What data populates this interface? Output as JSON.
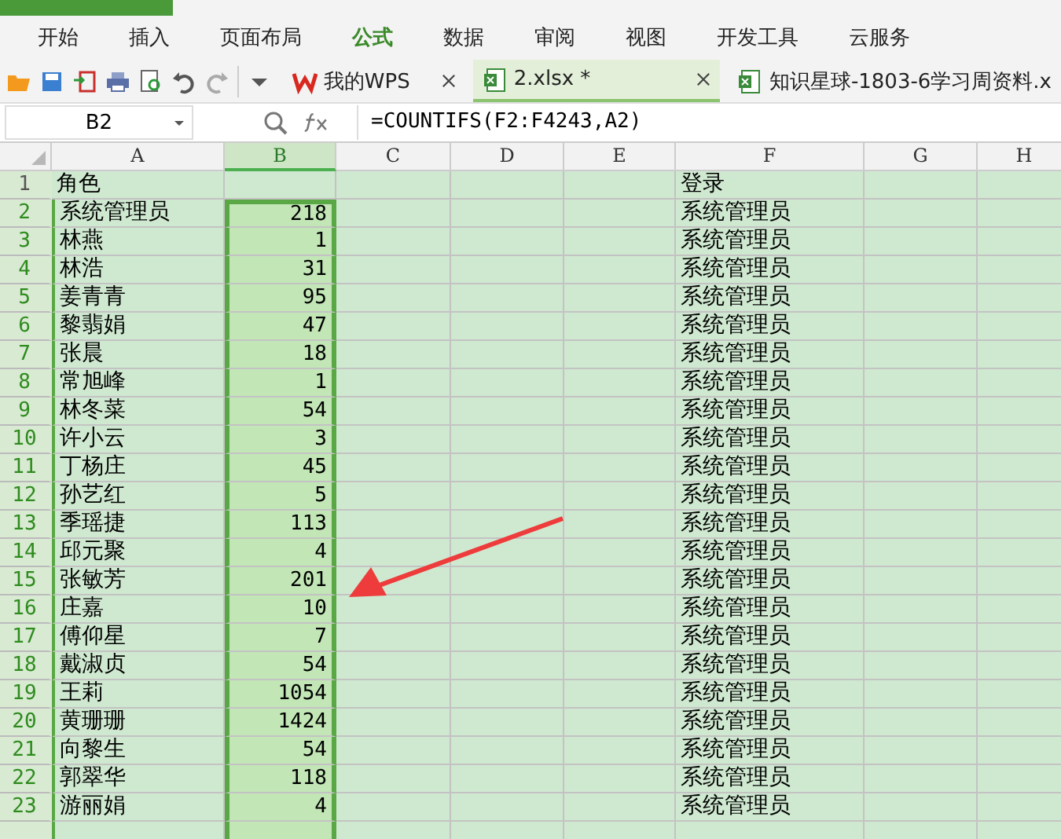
{
  "ribbon_tabs": [
    {
      "label": "开始",
      "selected": false
    },
    {
      "label": "插入",
      "selected": false
    },
    {
      "label": "页面布局",
      "selected": false
    },
    {
      "label": "公式",
      "selected": true
    },
    {
      "label": "数据",
      "selected": false
    },
    {
      "label": "审阅",
      "selected": false
    },
    {
      "label": "视图",
      "selected": false
    },
    {
      "label": "开发工具",
      "selected": false
    },
    {
      "label": "云服务",
      "selected": false
    }
  ],
  "doc_tabs": [
    {
      "kind": "wps",
      "label": "我的WPS",
      "selected": false
    },
    {
      "kind": "sheet",
      "label": "2.xlsx *",
      "selected": true
    },
    {
      "kind": "sheet",
      "label": "知识星球-1803-6学习周资料.x",
      "selected": false
    }
  ],
  "name_box": "B2",
  "formula": "=COUNTIFS(F2:F4243,A2)",
  "columns": [
    {
      "label": "A",
      "selected": false
    },
    {
      "label": "B",
      "selected": true
    },
    {
      "label": "C",
      "selected": false
    },
    {
      "label": "D",
      "selected": false
    },
    {
      "label": "E",
      "selected": false
    },
    {
      "label": "F",
      "selected": false
    },
    {
      "label": "G",
      "selected": false
    },
    {
      "label": "H",
      "selected": false
    }
  ],
  "rows": [
    {
      "number": "1",
      "selected": false,
      "a": "角色",
      "f": "登录"
    },
    {
      "number": "2",
      "selected": true,
      "a": "系统管理员",
      "b": "218",
      "f": "系统管理员"
    },
    {
      "number": "3",
      "selected": true,
      "a": "林燕",
      "b": "1",
      "f": "系统管理员"
    },
    {
      "number": "4",
      "selected": true,
      "a": "林浩",
      "b": "31",
      "f": "系统管理员"
    },
    {
      "number": "5",
      "selected": true,
      "a": "姜青青",
      "b": "95",
      "f": "系统管理员"
    },
    {
      "number": "6",
      "selected": true,
      "a": "黎翡娟",
      "b": "47",
      "f": "系统管理员"
    },
    {
      "number": "7",
      "selected": true,
      "a": "张晨",
      "b": "18",
      "f": "系统管理员"
    },
    {
      "number": "8",
      "selected": true,
      "a": "常旭峰",
      "b": "1",
      "f": "系统管理员"
    },
    {
      "number": "9",
      "selected": true,
      "a": "林冬菜",
      "b": "54",
      "f": "系统管理员"
    },
    {
      "number": "10",
      "selected": true,
      "a": "许小云",
      "b": "3",
      "f": "系统管理员"
    },
    {
      "number": "11",
      "selected": true,
      "a": "丁杨庄",
      "b": "45",
      "f": "系统管理员"
    },
    {
      "number": "12",
      "selected": true,
      "a": "孙艺红",
      "b": "5",
      "f": "系统管理员"
    },
    {
      "number": "13",
      "selected": true,
      "a": "季瑶捷",
      "b": "113",
      "f": "系统管理员"
    },
    {
      "number": "14",
      "selected": true,
      "a": "邱元聚",
      "b": "4",
      "f": "系统管理员"
    },
    {
      "number": "15",
      "selected": true,
      "a": "张敏芳",
      "b": "201",
      "f": "系统管理员"
    },
    {
      "number": "16",
      "selected": true,
      "a": "庄嘉",
      "b": "10",
      "f": "系统管理员"
    },
    {
      "number": "17",
      "selected": true,
      "a": "傅仰星",
      "b": "7",
      "f": "系统管理员"
    },
    {
      "number": "18",
      "selected": true,
      "a": "戴淑贞",
      "b": "54",
      "f": "系统管理员"
    },
    {
      "number": "19",
      "selected": true,
      "a": "王莉",
      "b": "1054",
      "f": "系统管理员"
    },
    {
      "number": "20",
      "selected": true,
      "a": "黄珊珊",
      "b": "1424",
      "f": "系统管理员"
    },
    {
      "number": "21",
      "selected": true,
      "a": "向黎生",
      "b": "54",
      "f": "系统管理员"
    },
    {
      "number": "22",
      "selected": true,
      "a": "郭翠华",
      "b": "118",
      "f": "系统管理员"
    },
    {
      "number": "23",
      "selected": true,
      "a": "游丽娟",
      "b": "4",
      "f": "系统管理员"
    }
  ]
}
